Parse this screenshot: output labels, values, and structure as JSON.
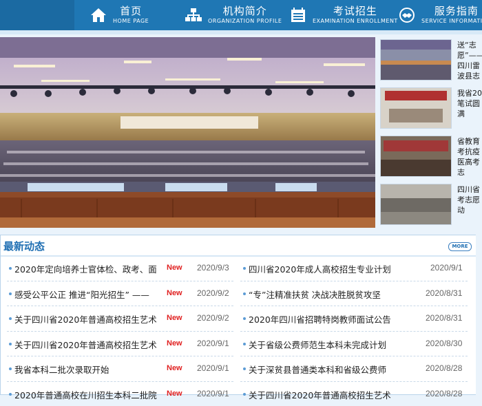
{
  "nav": [
    {
      "cn": "首页",
      "en": "HOME  PAGE",
      "icon": "home-icon"
    },
    {
      "cn": "机构简介",
      "en": "ORGANIZATION PROFILE",
      "icon": "org-chart-icon"
    },
    {
      "cn": "考试招生",
      "en": "EXAMINATION ENROLLMENT",
      "icon": "calendar-icon"
    },
    {
      "cn": "服务指南",
      "en": "SERVICE  INFORMATION",
      "icon": "handshake-icon"
    }
  ],
  "side_news": [
    "送“志愿”——四川雷波县志愿公",
    "我省20笔试圆满",
    "省教育考抗疫医高考志",
    "四川省考志愿动"
  ],
  "news": {
    "title": "最新动态",
    "more": "MORE",
    "new_label": "New",
    "left": [
      {
        "title": "2020年定向培养士官体检、政考、面",
        "date": "2020/9/3",
        "new": true
      },
      {
        "title": "感受公平公正 推进“阳光招生” ——",
        "date": "2020/9/2",
        "new": true
      },
      {
        "title": "关于四川省2020年普通高校招生艺术",
        "date": "2020/9/2",
        "new": true
      },
      {
        "title": "关于四川省2020年普通高校招生艺术",
        "date": "2020/9/1",
        "new": true
      },
      {
        "title": "我省本科二批次录取开始",
        "date": "2020/9/1",
        "new": true
      },
      {
        "title": "2020年普通高校在川招生本科二批院",
        "date": "2020/9/1",
        "new": true
      }
    ],
    "right": [
      {
        "title": "四川省2020年成人高校招生专业计划",
        "date": "2020/9/1"
      },
      {
        "title": "“专”注精准扶贫 决战决胜脱贫攻坚",
        "date": "2020/8/31"
      },
      {
        "title": "2020年四川省招聘特岗教师面试公告",
        "date": "2020/8/31"
      },
      {
        "title": "关于省级公费师范生本科未完成计划",
        "date": "2020/8/30"
      },
      {
        "title": "关于深贫县普通类本科和省级公费师",
        "date": "2020/8/28"
      },
      {
        "title": "关于四川省2020年普通高校招生艺术",
        "date": "2020/8/28"
      }
    ]
  }
}
